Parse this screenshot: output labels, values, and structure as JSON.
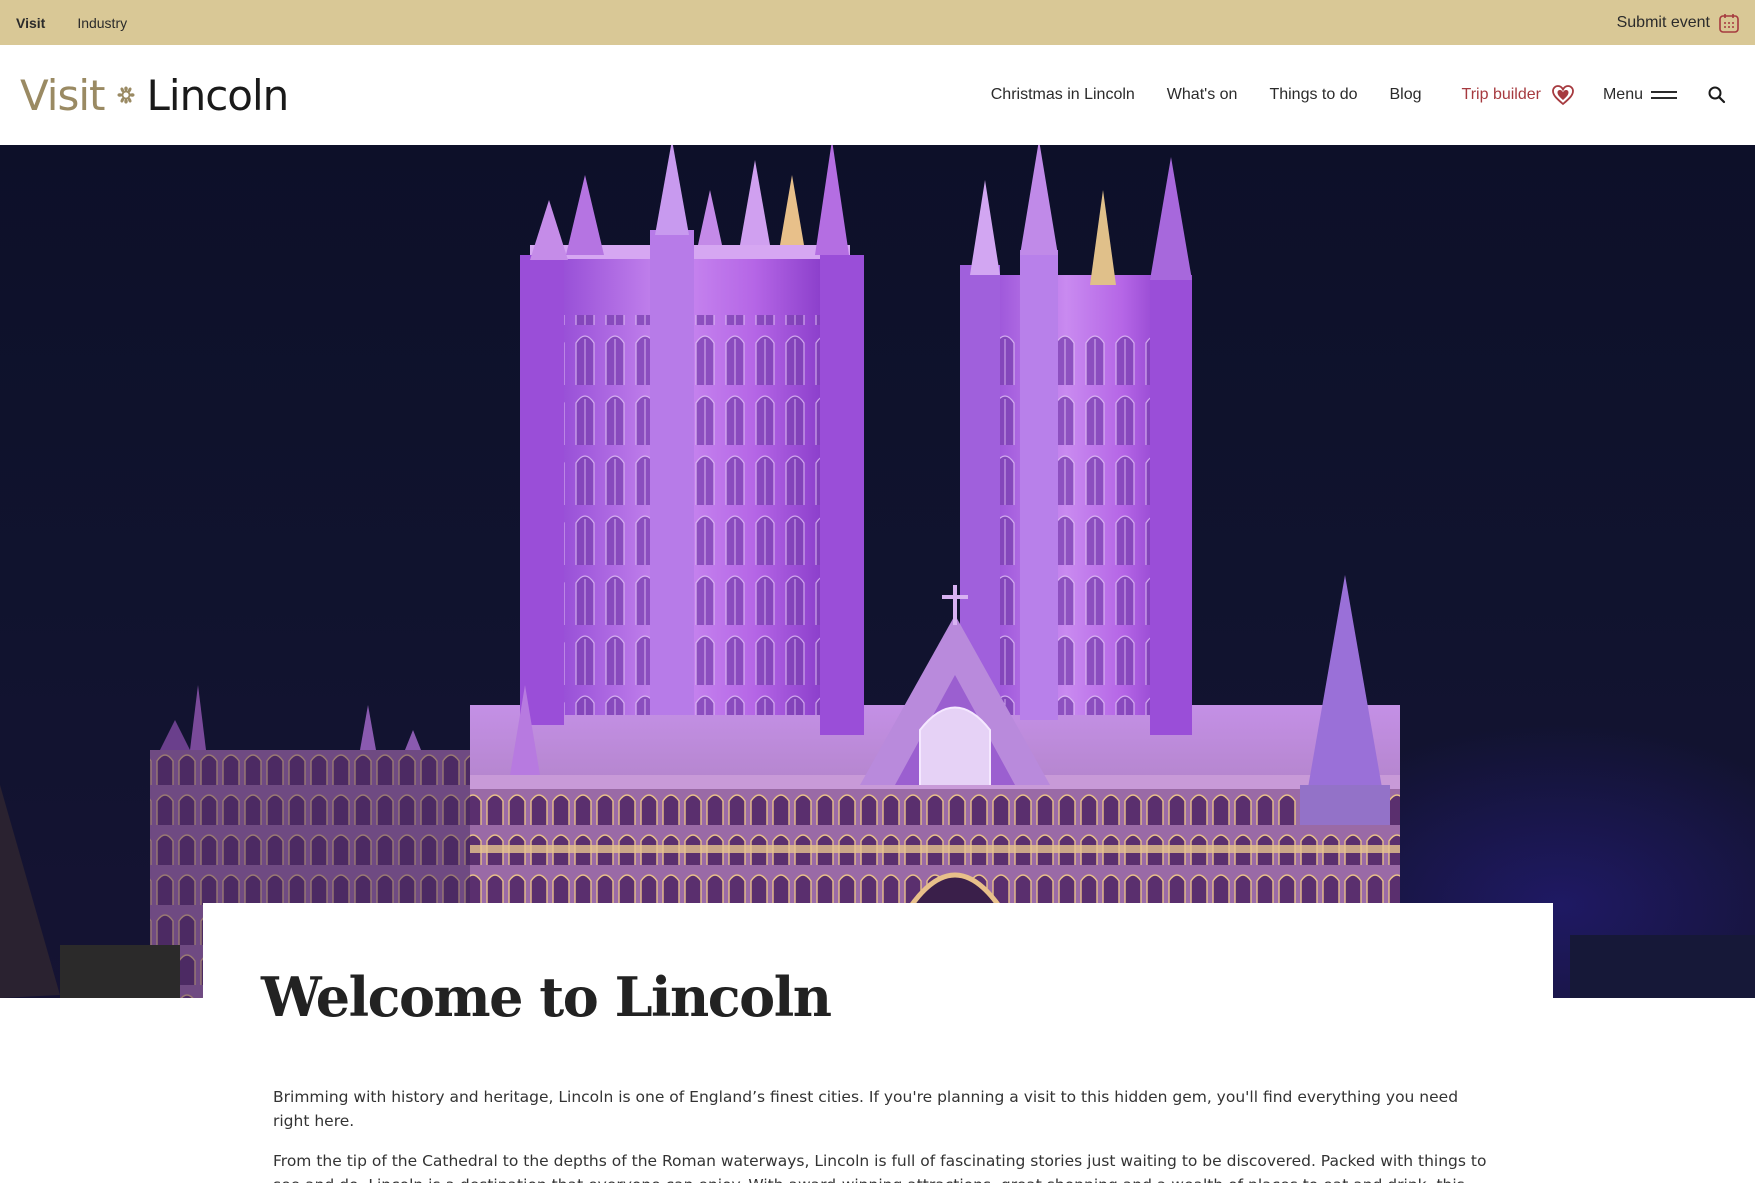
{
  "utility_bar": {
    "links": [
      {
        "label": "Visit",
        "active": true
      },
      {
        "label": "Industry",
        "active": false
      }
    ],
    "submit_event_label": "Submit event",
    "background_color": "#d9c896",
    "submit_icon": "calendar-icon"
  },
  "header": {
    "logo": {
      "visit": "Visit",
      "lincoln": "Lincoln",
      "emblem_icon": "flower-emblem-icon"
    },
    "nav": [
      {
        "label": "Christmas in Lincoln"
      },
      {
        "label": "What's on"
      },
      {
        "label": "Things to do"
      },
      {
        "label": "Blog"
      }
    ],
    "trip_builder_label": "Trip builder",
    "trip_builder_icon": "heart-icon",
    "trip_builder_color": "#a63a3f",
    "menu_label": "Menu",
    "menu_icon": "hamburger-icon",
    "search_icon": "search-icon"
  },
  "hero": {
    "image_subject": "Lincoln Cathedral illuminated purple at night"
  },
  "main": {
    "title": "Welcome to Lincoln",
    "paragraphs": [
      "Brimming with history and heritage, Lincoln is one of England’s finest cities.  If you're planning a visit to this hidden gem, you'll find everything you need right here.",
      "From the tip of the Cathedral to the depths of the Roman waterways, Lincoln is full of fascinating stories just waiting to be discovered. Packed with things to see and do, Lincoln is a destination that everyone can enjoy. With award-winning attractions, great shopping and a wealth of places to eat and drink, this beautiful"
    ]
  }
}
